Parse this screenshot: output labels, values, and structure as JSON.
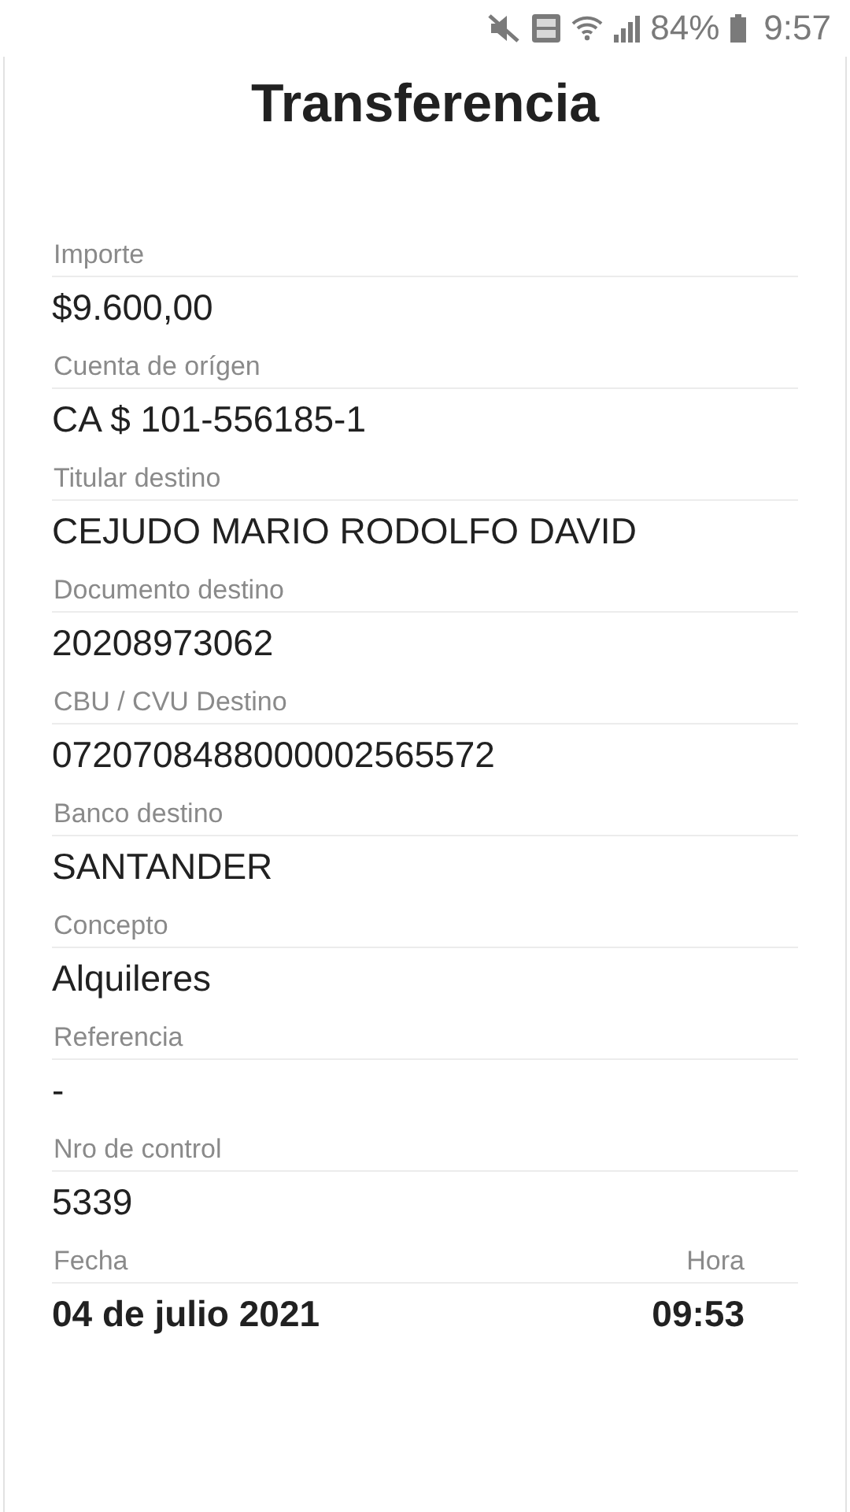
{
  "status_bar": {
    "battery": "84%",
    "time": "9:57"
  },
  "title": "Transferencia",
  "fields": [
    {
      "label": "Importe",
      "value": "$9.600,00"
    },
    {
      "label": "Cuenta de orígen",
      "value": "CA $ 101-556185-1"
    },
    {
      "label": "Titular destino",
      "value": "CEJUDO MARIO RODOLFO DAVID"
    },
    {
      "label": "Documento destino",
      "value": "20208973062"
    },
    {
      "label": "CBU / CVU Destino",
      "value": "0720708488000002565572"
    },
    {
      "label": "Banco destino",
      "value": "SANTANDER"
    },
    {
      "label": "Concepto",
      "value": "Alquileres"
    },
    {
      "label": "Referencia",
      "value": "-"
    },
    {
      "label": "Nro de control",
      "value": "5339"
    }
  ],
  "date_time": [
    {
      "label": "Fecha",
      "value": "04 de julio 2021"
    },
    {
      "label": "Hora",
      "value": "09:53"
    }
  ]
}
